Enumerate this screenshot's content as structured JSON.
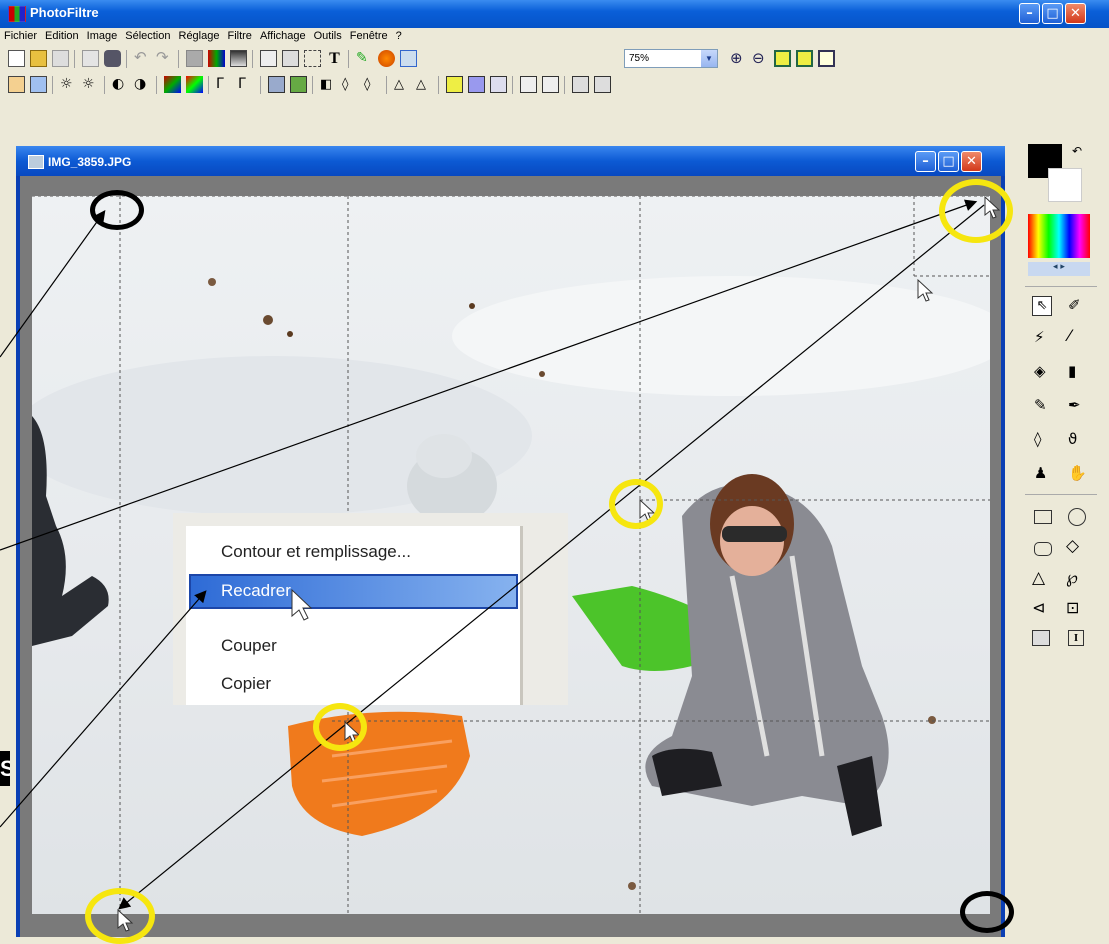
{
  "app": {
    "title": "PhotoFiltre",
    "min_label": "–",
    "max_label": "□",
    "close_label": "✕"
  },
  "menu": [
    "Fichier",
    "Edition",
    "Image",
    "Sélection",
    "Réglage",
    "Filtre",
    "Affichage",
    "Outils",
    "Fenêtre",
    "?"
  ],
  "zoom": {
    "value": "75%"
  },
  "document": {
    "title": "IMG_3859.JPG",
    "min_label": "–",
    "max_label": "□",
    "close_label": "✕"
  },
  "context_menu": {
    "items": [
      "Contour et remplissage...",
      "Recadrer",
      "Couper",
      "Copier"
    ],
    "selected": "Recadrer"
  },
  "annotation_badge": "S",
  "colors": {
    "title_bar": "#0a5fd8",
    "highlight_circle": "#f6e60f",
    "menu_highlight": "#2e6bd6",
    "sled_orange": "#f07a1c",
    "sled_green": "#4cc42a"
  },
  "icons": {
    "toolbar1": [
      "new-file-icon",
      "open-icon",
      "save-icon",
      "print-icon",
      "scanner-icon",
      "undo-icon",
      "redo-icon",
      "grayscale-icon",
      "color-icon",
      "gradient-icon",
      "copy-icon",
      "paste-icon",
      "crop-icon",
      "text-icon",
      "transform-icon",
      "filter-icon",
      "image-icon",
      "zoom-in-icon",
      "zoom-out-icon",
      "fit-icon",
      "fit-full-icon",
      "slideshow-icon"
    ],
    "tools": [
      "select-arrow-icon",
      "eyedropper-icon",
      "magic-wand-icon",
      "line-icon",
      "fill-bucket-icon",
      "spray-icon",
      "brush-icon",
      "pen-icon",
      "blur-icon",
      "smudge-icon",
      "stamp-icon",
      "hand-icon",
      "rectangle-icon",
      "ellipse-icon",
      "rounded-rect-icon",
      "diamond-icon",
      "triangle-icon",
      "lasso-icon",
      "polygon-icon",
      "open-shape-icon",
      "rule-icon",
      "text-cursor-icon"
    ]
  }
}
